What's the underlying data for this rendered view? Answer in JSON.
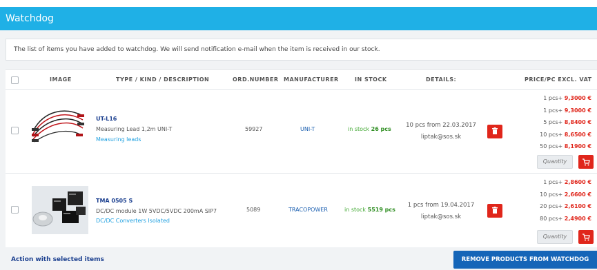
{
  "header": {
    "title": "Watchdog"
  },
  "info": {
    "text": "The list of items you have added to watchdog. We will send notification e-mail when the item is received in our stock."
  },
  "table": {
    "columns": {
      "image": "IMAGE",
      "type": "TYPE / KIND / DESCRIPTION",
      "ord": "ORD.NUMBER",
      "manufacturer": "MANUFACTURER",
      "stock": "IN STOCK",
      "details": "DETAILS:",
      "price": "PRICE/PC EXCL. VAT"
    },
    "rows": [
      {
        "name": "UT-L16",
        "description": "Measuring Lead 1,2m UNI-T",
        "category": "Measuring leads",
        "ord_number": "59927",
        "manufacturer": "UNI-T",
        "stock_prefix": "in stock",
        "stock_qty": "26 pcs",
        "detail_line1": "10 pcs from 22.03.2017",
        "detail_line2": "liptak@sos.sk",
        "prices": [
          {
            "qty": "1 pcs+",
            "price": "9,3000 €"
          },
          {
            "qty": "1 pcs+",
            "price": "9,3000 €"
          },
          {
            "qty": "5 pcs+",
            "price": "8,8400 €"
          },
          {
            "qty": "10 pcs+",
            "price": "8,6500 €"
          },
          {
            "qty": "50 pcs+",
            "price": "8,1900 €"
          }
        ],
        "quantity_placeholder": "Quantity"
      },
      {
        "name": "TMA 0505 S",
        "description": "DC/DC module 1W 5VDC/5VDC 200mA SIP7",
        "category": "DC/DC Converters Isolated",
        "ord_number": "5089",
        "manufacturer": "TRACOPOWER",
        "stock_prefix": "in stock",
        "stock_qty": "5519 pcs",
        "detail_line1": "1 pcs from 19.04.2017",
        "detail_line2": "liptak@sos.sk",
        "prices": [
          {
            "qty": "1 pcs+",
            "price": "2,8600 €"
          },
          {
            "qty": "10 pcs+",
            "price": "2,6600 €"
          },
          {
            "qty": "20 pcs+",
            "price": "2,6100 €"
          },
          {
            "qty": "80 pcs+",
            "price": "2,4900 €"
          }
        ],
        "quantity_placeholder": "Quantity"
      }
    ]
  },
  "footer": {
    "action_label": "Action with selected items",
    "remove_button": "REMOVE PRODUCTS FROM WATCHDOG"
  },
  "colors": {
    "title_bar": "#1fb0e6",
    "price_red": "#e0261b",
    "stock_green": "#41a832",
    "link_blue": "#1b3f8f",
    "button_blue": "#1565b8"
  }
}
